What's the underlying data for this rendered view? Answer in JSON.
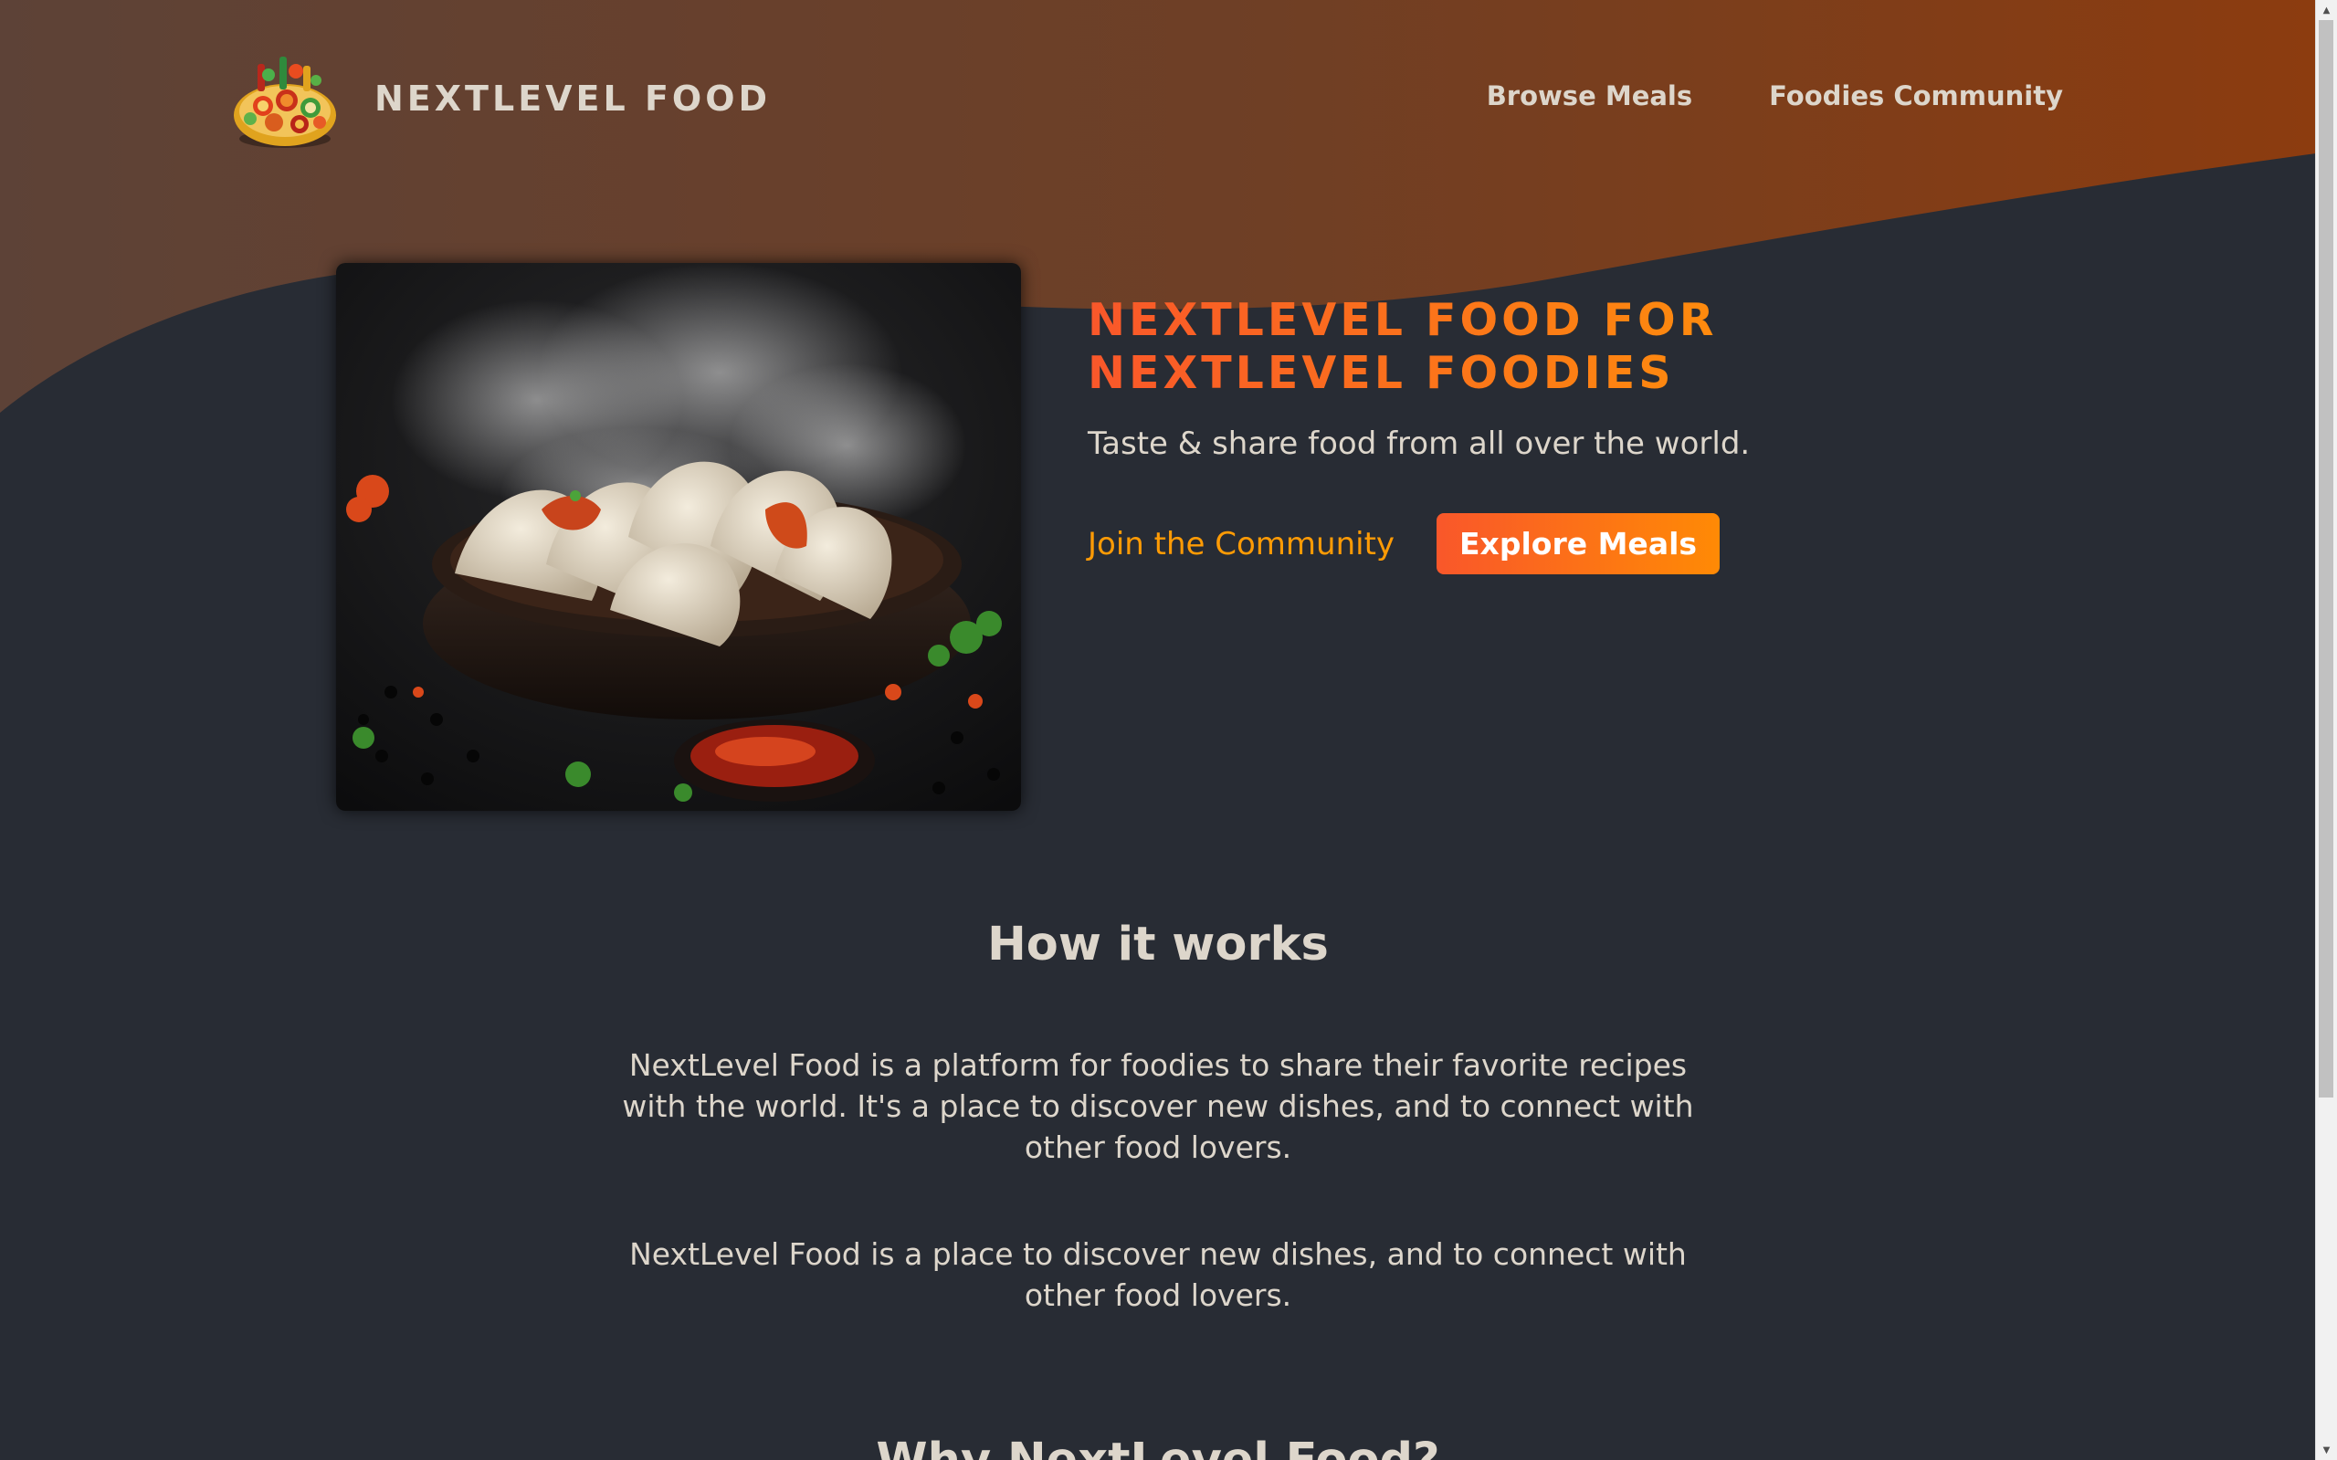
{
  "header": {
    "logo_text": "NEXTLEVEL FOOD",
    "nav": [
      "Browse Meals",
      "Foodies Community"
    ]
  },
  "hero": {
    "title_line1": "NEXTLEVEL FOOD FOR",
    "title_line2": "NEXTLEVEL FOODIES",
    "subtitle": "Taste & share food from all over the world.",
    "join_label": "Join the Community",
    "explore_label": "Explore Meals"
  },
  "how_it_works": {
    "heading": "How it works",
    "paragraph1": "NextLevel Food is a platform for foodies to share their favorite recipes with the world. It's a place to discover new dishes, and to connect with other food lovers.",
    "paragraph2": "NextLevel Food is a place to discover new dishes, and to connect with other food lovers."
  },
  "next_section": {
    "heading": "Why NextLevel Food?"
  },
  "colors": {
    "background": "#282c34",
    "header_gradient_start": "#5b4139",
    "header_gradient_end": "#8a3c12",
    "accent_start": "#f9572a",
    "accent_end": "#ff9b05",
    "text": "#ddd6cb"
  },
  "icons": [
    "logo-food-plate-icon",
    "scroll-up-arrow-icon",
    "scroll-down-arrow-icon"
  ]
}
